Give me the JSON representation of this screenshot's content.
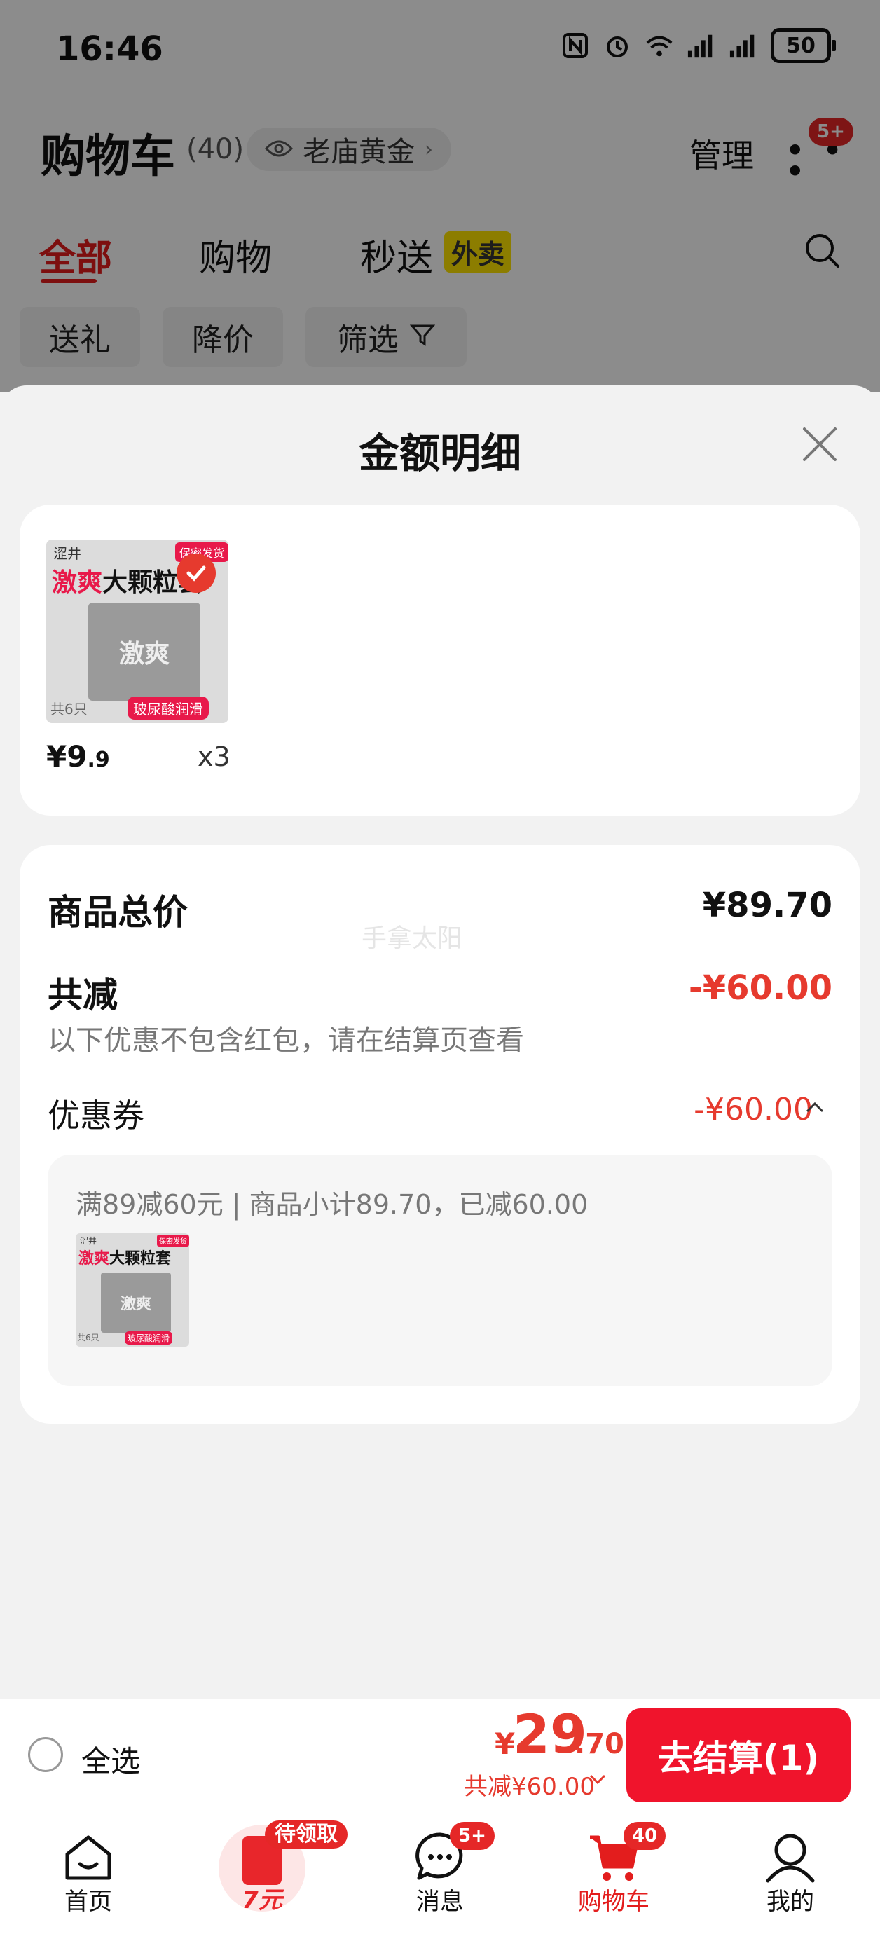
{
  "status_bar": {
    "time": "16:46",
    "battery": "50"
  },
  "header": {
    "title": "购物车",
    "count": "(40)",
    "store_label": "老庙黄金",
    "manage_label": "管理",
    "more_badge": "5+"
  },
  "tabs": [
    {
      "label": "全部"
    },
    {
      "label": "购物"
    },
    {
      "label": "秒送"
    }
  ],
  "tab_tag": "外卖",
  "chips": [
    {
      "label": "送礼"
    },
    {
      "label": "降价"
    },
    {
      "label": "筛选"
    }
  ],
  "sheet": {
    "title": "金额明细",
    "product": {
      "brand": "涩井",
      "name_red": "激爽",
      "name_black": "大颗粒套",
      "tag": "保密发货",
      "box_text": "激爽",
      "count": "共6只",
      "feature": "玻尿酸润滑",
      "price_int": "¥9",
      "price_dec": ".9",
      "qty": "x3"
    },
    "summary": {
      "total_label": "商品总价",
      "total_value": "¥89.70",
      "discount_label": "共减",
      "discount_value": "-¥60.00",
      "note": "以下优惠不包含红包，请在结算页查看",
      "coupon_label": "优惠券",
      "coupon_value": "-¥60.00",
      "coupon_desc": "满89减60元 | 商品小计89.70，已减60.00"
    },
    "watermark": "手拿太阳"
  },
  "checkout": {
    "select_all": "全选",
    "total_yen": "¥",
    "total_int": "29",
    "total_dec": ".70",
    "discount": "共减¥60.00",
    "button": "去结算(1)"
  },
  "nav": [
    {
      "label": "首页"
    },
    {
      "label": "",
      "promo_badge": "待领取",
      "promo_amount": "7元"
    },
    {
      "label": "消息",
      "badge": "5+"
    },
    {
      "label": "购物车",
      "badge": "40"
    },
    {
      "label": "我的"
    }
  ],
  "colors": {
    "accent_red": "#e31d1d",
    "price_red": "#e63a2e",
    "button_red": "#f0142c",
    "tag_yellow": "#ffe400"
  }
}
